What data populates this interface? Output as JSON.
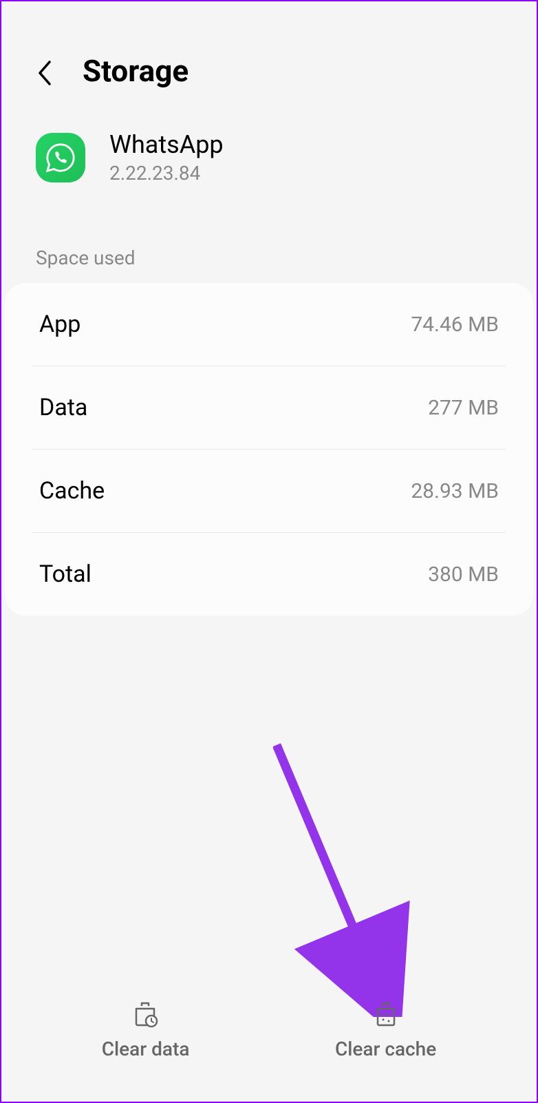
{
  "header": {
    "title": "Storage"
  },
  "app": {
    "name": "WhatsApp",
    "version": "2.22.23.84"
  },
  "section_title": "Space used",
  "storage": {
    "app": {
      "label": "App",
      "value": "74.46 MB"
    },
    "data": {
      "label": "Data",
      "value": "277 MB"
    },
    "cache": {
      "label": "Cache",
      "value": "28.93 MB"
    },
    "total": {
      "label": "Total",
      "value": "380 MB"
    }
  },
  "buttons": {
    "clear_data": "Clear data",
    "clear_cache": "Clear cache"
  }
}
